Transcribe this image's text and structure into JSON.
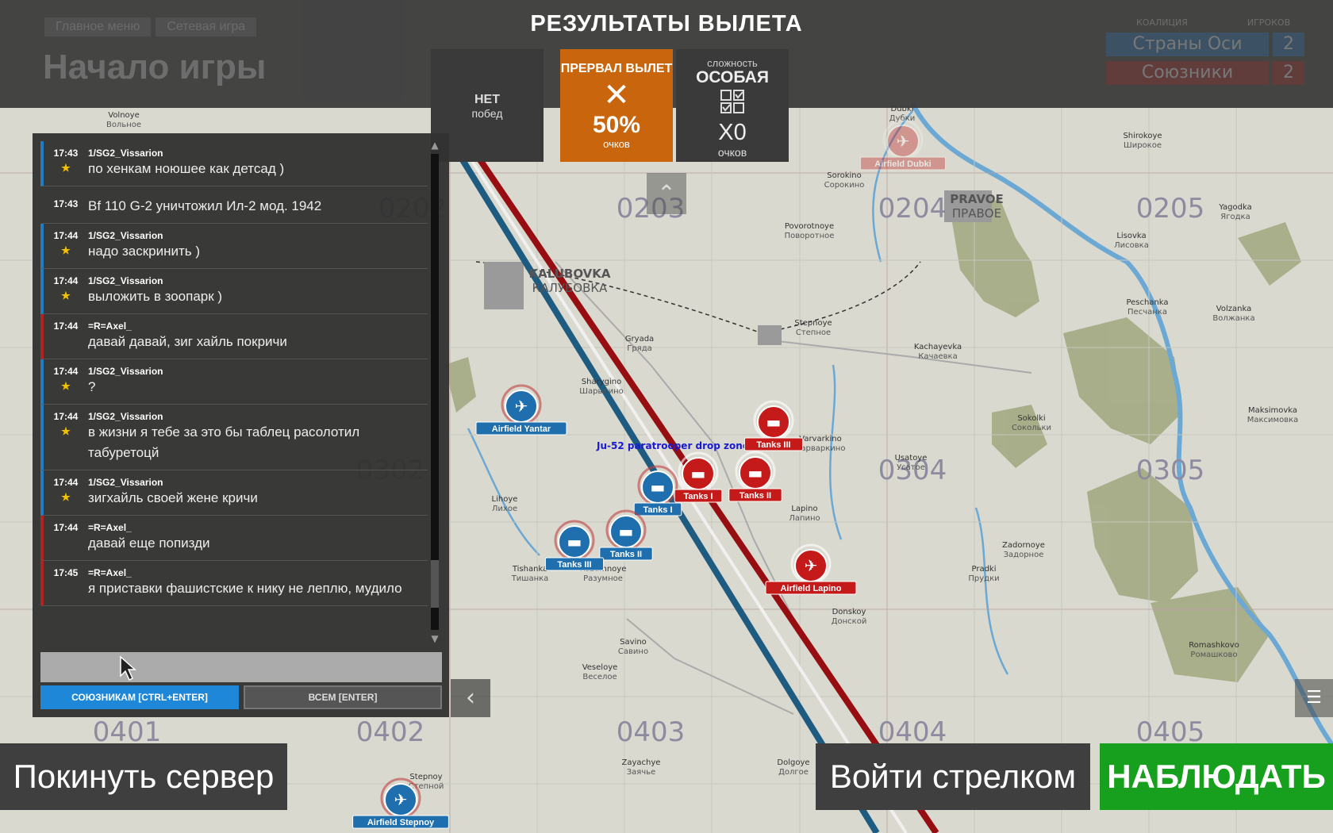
{
  "topbar": {
    "breadcrumb": [
      "Главное меню",
      "Сетевая игра"
    ],
    "page_title": "Начало игры",
    "coalition": {
      "header_coalition": "КОАЛИЦИЯ",
      "header_players": "ИГРОКОВ",
      "rows": [
        {
          "name": "Страны Оси",
          "count": "2"
        },
        {
          "name": "Союзники",
          "count": "2"
        }
      ]
    }
  },
  "results": {
    "title": "РЕЗУЛЬТАТЫ ВЫЛЕТА",
    "wins": {
      "line1": "НЕТ",
      "line2": "побед"
    },
    "aborted": {
      "label": "ПРЕРВАЛ ВЫЛЕТ",
      "icon": "close-icon",
      "percent": "50%",
      "unit": "очков",
      "color": "#c9650c"
    },
    "difficulty": {
      "label": "сложность",
      "value": "ОСОБАЯ",
      "icon": "checklist-icon",
      "multiplier": "X0",
      "unit": "очков"
    }
  },
  "chat": {
    "messages": [
      {
        "time": "17:43",
        "author": "1/SG2_Vissarion",
        "text": "по хенкам ноюшее как детсад )",
        "side": "blue",
        "star": true
      },
      {
        "time": "17:43",
        "author": "",
        "text": "Bf 110 G-2 уничтожил Ил-2 мод. 1942",
        "side": "sys",
        "star": false
      },
      {
        "time": "17:44",
        "author": "1/SG2_Vissarion",
        "text": "надо заскринить )",
        "side": "blue",
        "star": true
      },
      {
        "time": "17:44",
        "author": "1/SG2_Vissarion",
        "text": "выложить в зоопарк )",
        "side": "blue",
        "star": true
      },
      {
        "time": "17:44",
        "author": "=R=Axel_",
        "text": "давай давай, зиг хайль покричи",
        "side": "red",
        "star": false
      },
      {
        "time": "17:44",
        "author": "1/SG2_Vissarion",
        "text": "?",
        "side": "blue",
        "star": true
      },
      {
        "time": "17:44",
        "author": "1/SG2_Vissarion",
        "text": "в жизни я тебе за это бы таблец расолотил табуретоцй",
        "side": "blue",
        "star": true
      },
      {
        "time": "17:44",
        "author": "1/SG2_Vissarion",
        "text": "зигхайль своей жене кричи",
        "side": "blue",
        "star": true
      },
      {
        "time": "17:44",
        "author": "=R=Axel_",
        "text": "давай еще попизди",
        "side": "red",
        "star": false
      },
      {
        "time": "17:45",
        "author": "=R=Axel_",
        "text": "я приставки фашистские к нику не леплю, мудило",
        "side": "red",
        "star": false
      }
    ],
    "input_value": "",
    "btn_allies": "СОЮЗНИКАМ [CTRL+ENTER]",
    "btn_all": "ВСЕМ [ENTER]",
    "star_glyph": "★"
  },
  "buttons": {
    "leave": "Покинуть сервер",
    "gunner": "Войти стрелком",
    "observe": "НАБЛЮДАТЬ",
    "collapse_glyph": "‹",
    "up_glyph": "⌃",
    "list_glyph": "☰"
  },
  "map": {
    "grid_labels": [
      "0202",
      "0203",
      "0204",
      "0205",
      "0302",
      "0304",
      "0305",
      "0401",
      "0402",
      "0403",
      "0404",
      "0405"
    ],
    "towns": [
      {
        "name": "PRAVOE",
        "sub": "ПРАВОЕ",
        "major": true
      },
      {
        "name": "KALUBOVKA",
        "sub": "КАЛУБОВКА",
        "major": true
      },
      {
        "name": "Sorokino",
        "sub": "Сорокино"
      },
      {
        "name": "Povorotnoye",
        "sub": "Поворотное"
      },
      {
        "name": "Yagodka",
        "sub": "Ягодка"
      },
      {
        "name": "Lisovka",
        "sub": "Лисовка"
      },
      {
        "name": "Peschanka",
        "sub": "Песчанка"
      },
      {
        "name": "Volzanka",
        "sub": "Волжанка"
      },
      {
        "name": "Stepnoye",
        "sub": "Степное"
      },
      {
        "name": "Gryada",
        "sub": "Гряда"
      },
      {
        "name": "Kachayevka",
        "sub": "Качаевка"
      },
      {
        "name": "Sharygino",
        "sub": "Шарыгино"
      },
      {
        "name": "Varvarkino",
        "sub": "Варваркино"
      },
      {
        "name": "Usatoye",
        "sub": "Усатое"
      },
      {
        "name": "Sokolki",
        "sub": "Сокольки"
      },
      {
        "name": "Maksimovka",
        "sub": "Максимовка"
      },
      {
        "name": "Lihoye",
        "sub": "Лихое"
      },
      {
        "name": "Lapino",
        "sub": "Лапино"
      },
      {
        "name": "Zadornoye",
        "sub": "Задорное"
      },
      {
        "name": "Tishanka",
        "sub": "Тишанка"
      },
      {
        "name": "Razumnoye",
        "sub": "Разумное"
      },
      {
        "name": "Pradki",
        "sub": "Прудки"
      },
      {
        "name": "Donskoy",
        "sub": "Донской"
      },
      {
        "name": "Savino",
        "sub": "Савино"
      },
      {
        "name": "Veseloye",
        "sub": "Веселое"
      },
      {
        "name": "Romashkovo",
        "sub": "Ромашково"
      },
      {
        "name": "Zayachye",
        "sub": "Заячье"
      },
      {
        "name": "Dolgoye",
        "sub": "Долгое"
      },
      {
        "name": "Stepnoy",
        "sub": "Степной"
      },
      {
        "name": "Dubki",
        "sub": "Дубки"
      },
      {
        "name": "Shirokoye",
        "sub": "Широкое"
      },
      {
        "name": "Volnoye",
        "sub": "Вольное"
      }
    ],
    "markers": [
      {
        "label": "Airfield Yantar",
        "side": "blue",
        "icon": "airfield-icon"
      },
      {
        "label": "Tanks I",
        "side": "blue",
        "icon": "tank-icon"
      },
      {
        "label": "Tanks II",
        "side": "blue",
        "icon": "tank-icon"
      },
      {
        "label": "Tanks III",
        "side": "blue",
        "icon": "tank-icon"
      },
      {
        "label": "Airfield Stepnoy",
        "side": "blue",
        "icon": "airfield-icon"
      },
      {
        "label": "Tanks I",
        "side": "red",
        "icon": "tank-icon"
      },
      {
        "label": "Tanks II",
        "side": "red",
        "icon": "tank-icon"
      },
      {
        "label": "Tanks III",
        "side": "red",
        "icon": "tank-icon"
      },
      {
        "label": "Airfield Lapino",
        "side": "red",
        "icon": "airfield-icon"
      },
      {
        "label": "Airfield Dubki",
        "side": "red",
        "icon": "airfield-icon"
      }
    ],
    "drop_zone": "Ju-52 paratrooper drop zone",
    "colors": {
      "blue": "#1f6fae",
      "red": "#c41a1a",
      "front_blue": "#1e5b80",
      "front_red": "#960d12",
      "land": "#d8d8ce",
      "river": "#6ba8d4",
      "forest": "#9aa47a"
    }
  }
}
